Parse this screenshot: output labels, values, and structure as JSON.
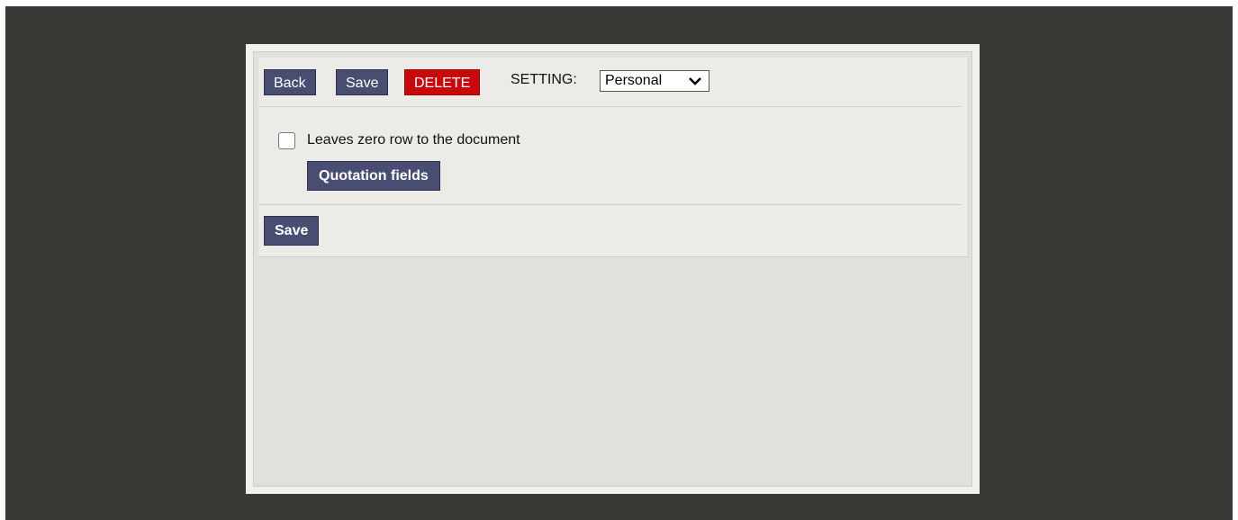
{
  "toolbar": {
    "back_label": "Back",
    "save_label": "Save",
    "delete_label": "DELETE",
    "setting_label": "SETTING:",
    "setting_value": "Personal"
  },
  "options": {
    "zero_row_label": "Leaves zero row to the document",
    "zero_row_checked": false,
    "quotation_fields_label": "Quotation fields"
  },
  "footer": {
    "save_label": "Save"
  },
  "colors": {
    "backdrop": "#3b3936",
    "button": "#4a4d72",
    "delete_button": "#c8090c"
  },
  "icons": {
    "select_chevron": "chevron-down-icon"
  }
}
